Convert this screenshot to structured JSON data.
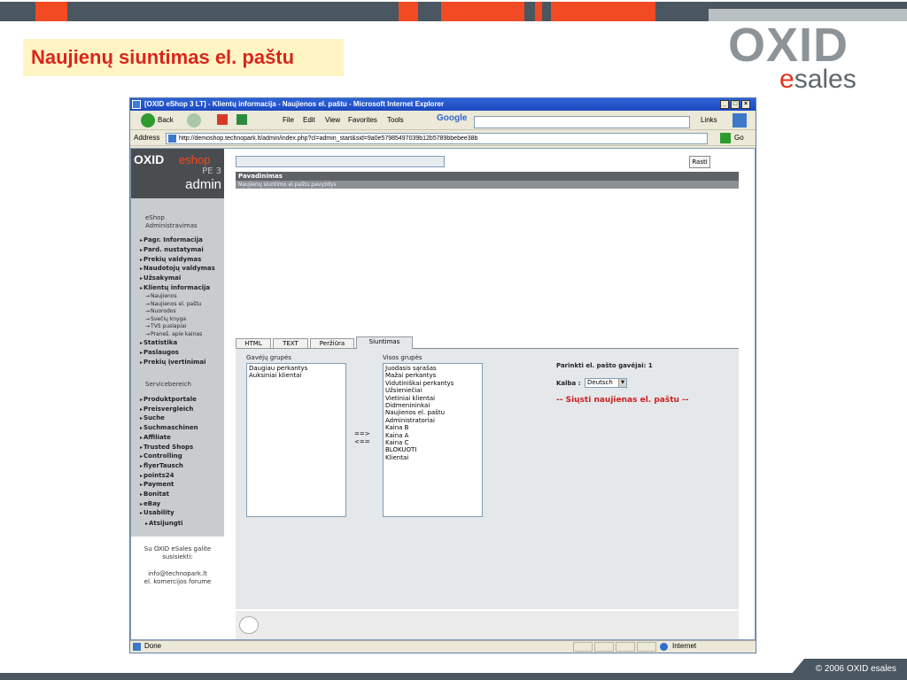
{
  "slide": {
    "title": "Naujienų siuntimas el. paštu",
    "logo_oxid": "OXID",
    "logo_e": "e",
    "logo_sales": "sales",
    "footer": "© 2006 OXID esales"
  },
  "browser": {
    "title": "[OXID eShop 3 LT] - Klientų informacija - Naujienos el. paštu - Microsoft Internet Explorer",
    "min": "_",
    "max": "□",
    "close": "×",
    "back": "Back",
    "menu": [
      "File",
      "Edit",
      "View",
      "Favorites",
      "Tools"
    ],
    "google": "Google",
    "links": "Links",
    "address_label": "Address",
    "address": "http://demoshop.technopark.lt/admin/index.php?cl=admin_start&sid=9a0e57985497039b12b5789bbebee38b",
    "go": "Go",
    "status": "Done",
    "zone": "Internet"
  },
  "nav": {
    "brand_oxid": "OXID",
    "brand_eshop": "eshop",
    "edition": "PE 3",
    "admin": "admin",
    "section1": "eShop Administravimas",
    "items1": [
      "Pagr. Informacija",
      "Pard. nustatymai",
      "Prekių valdymas",
      "Naudotojų valdymas",
      "Užsakymai",
      "Klientų informacija"
    ],
    "subitems": [
      "Naujienos",
      "Naujienos el. paštu",
      "Nuorodos",
      "Svečių knyga",
      "TVS puslapiai",
      "Praneš. apie kainas"
    ],
    "items2": [
      "Statistika",
      "Paslaugos",
      "Prekių įvertinimai"
    ],
    "section2": "Servicebereich",
    "items3": [
      "Produktportale",
      "Preisvergleich",
      "Suche",
      "Suchmaschinen",
      "Affiliate",
      "Trusted Shops",
      "Controlling",
      "flyerTausch",
      "points24",
      "Payment",
      "Bonitat",
      "eBay",
      "Usability"
    ],
    "logout": "Atsijungti",
    "info_line1": "Su OXID eSales galite susisiekti:",
    "info_line2": "info@technopark.lt",
    "info_line3": "el. komercijos forume"
  },
  "main": {
    "search_button": "Rasti",
    "list_header": "Pavadinimas",
    "list_row": "Naujienų siuntimo el.paštu pavyzdys",
    "tabs": [
      "HTML",
      "TEXT",
      "Peržiūra",
      "Siuntimas"
    ],
    "groups_label": "Gavėjų grupės",
    "groups": [
      "Daugiau perkantys",
      "Auksiniai klientai"
    ],
    "all_groups_label": "Visos grupės",
    "all_groups": [
      "Juodasis sąrašas",
      "Mažai perkantys",
      "Vidutiniškai perkantys",
      "Užsieniečiai",
      "Vietiniai klientai",
      "Didmenininkai",
      "Naujienos el. paštu",
      "Administratoriai",
      "Kaina B",
      "Kaina A",
      "Kaina C",
      "BLOKUOTI",
      "Klientai"
    ],
    "arrow_right": "==>",
    "arrow_left": "<==",
    "recipients": "Parinkti el. pašto gavėjai: 1",
    "lang_label": "Kalba :",
    "lang_value": "Deutsch",
    "send": "-- Siųsti naujienas el. paštu --"
  },
  "colors": {
    "accent": "#f24a22",
    "title_red": "#d9261c",
    "send_red": "#cc1f1f"
  }
}
